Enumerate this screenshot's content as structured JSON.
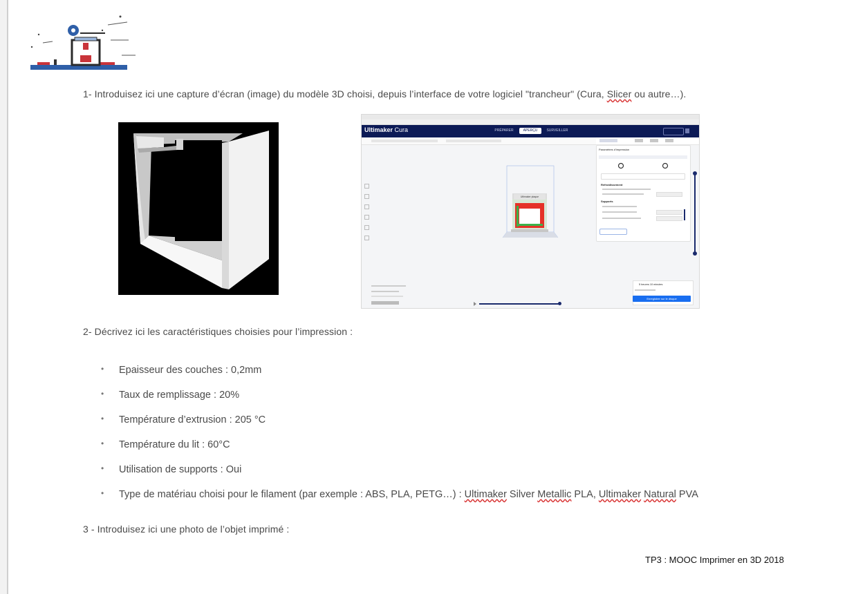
{
  "questions": {
    "q1_before": "1- Introduisez ici une capture d’écran (image) du modèle 3D choisi, depuis l’interface de votre logiciel \"trancheur\" (Cura, ",
    "q1_spell": "Slicer",
    "q1_after": " ou autre…).",
    "q2": "2- Décrivez ici les caractéristiques choisies pour l’impression :",
    "q3": "3 - Introduisez ici une photo de l’objet imprimé :"
  },
  "specs": [
    "Epaisseur des couches : 0,2mm",
    "Taux de remplissage : 20%",
    "Température d’extrusion : 205 °C",
    "Température du lit : 60°C",
    "Utilisation de supports : Oui"
  ],
  "material": {
    "prefix": "Type de matériau choisi pour le filament (par exemple : ABS, PLA, PETG…) : ",
    "w1": "Ultimaker",
    "t1": " Silver ",
    "w2": "Metallic",
    "t2": " PLA, ",
    "w3": "Ultimaker",
    "t3": " ",
    "w4": "Natural",
    "t4": " PVA"
  },
  "footer": "TP3 : MOOC Imprimer en 3D 2018",
  "cura": {
    "brand": "Ultimaker",
    "brand_sub": "Cura",
    "tabs": [
      "PRÉPARER",
      "APERÇU",
      "SURVEILLER"
    ],
    "active_tab": "APERÇU",
    "panel_title": "Paramètres d’impression",
    "section_adhesion": "Refroidissement",
    "section_support": "Supports",
    "object_label": "Ultimaker plaque",
    "time": "5 heures 10 minutes",
    "slice_button": "Enregistrer sur le disque"
  },
  "colors": {
    "cura_header": "#0c1a56",
    "cura_accent": "#196ef0",
    "spell_underline": "#d83030"
  }
}
